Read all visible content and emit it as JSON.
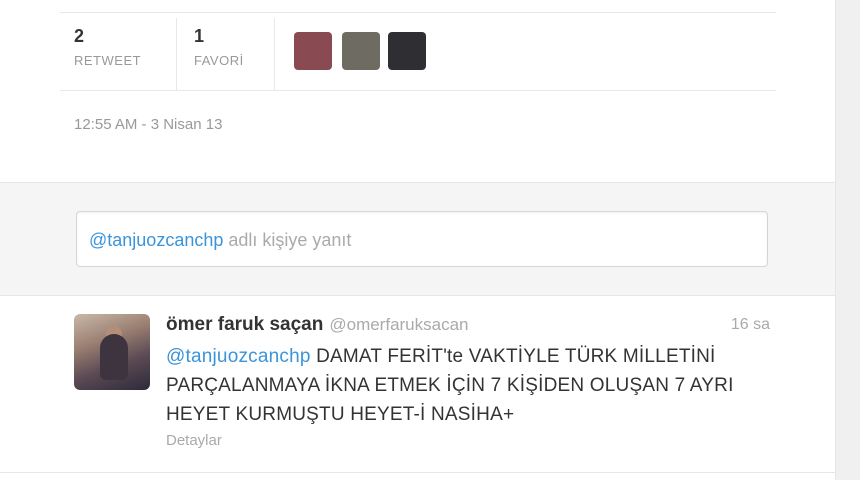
{
  "stats": {
    "retweets": {
      "count": "2",
      "label": "RETWEET"
    },
    "favorites": {
      "count": "1",
      "label": "FAVORİ"
    }
  },
  "favoriters": [
    {
      "name": "favoriter-avatar-1",
      "color": "#8a4a52"
    },
    {
      "name": "favoriter-avatar-2",
      "color": "#6e6c62"
    },
    {
      "name": "favoriter-avatar-3",
      "color": "#2f2f33"
    }
  ],
  "timestamp": "12:55 AM - 3 Nisan 13",
  "reply": {
    "mention": "@tanjuozcanchp",
    "placeholder": " adlı kişiye yanıt"
  },
  "tweet": {
    "fullname": "ömer faruk saçan",
    "username": "@omerfaruksacan",
    "time": "16 sa",
    "mention": "@tanjuozcanchp",
    "text": " DAMAT FERİT'te VAKTİYLE TÜRK MİLLETİNİ PARÇALANMAYA İKNA ETMEK İÇİN 7 KİŞİDEN OLUŞAN 7 AYRI HEYET KURMUŞTU HEYET-İ NASİHA+",
    "details": "Detaylar"
  }
}
